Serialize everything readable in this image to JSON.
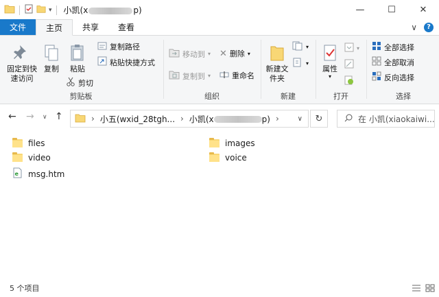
{
  "window": {
    "title_prefix": "小凯(x",
    "title_suffix": "p)",
    "minimize": "—",
    "maximize": "☐",
    "close": "✕"
  },
  "tabs": {
    "file": "文件",
    "home": "主页",
    "share": "共享",
    "view": "查看",
    "collapse": "∨",
    "help": "?"
  },
  "ribbon": {
    "clipboard": {
      "label": "剪贴板",
      "pin": "固定到快速访问",
      "copy": "复制",
      "paste": "粘贴",
      "copy_path": "复制路径",
      "paste_shortcut": "粘贴快捷方式",
      "cut": "剪切"
    },
    "organize": {
      "label": "组织",
      "move_to": "移动到",
      "copy_to": "复制到",
      "delete": "删除",
      "rename": "重命名"
    },
    "new": {
      "label": "新建",
      "new_folder": "新建文件夹"
    },
    "open": {
      "label": "打开",
      "properties": "属性"
    },
    "select": {
      "label": "选择",
      "select_all": "全部选择",
      "select_none": "全部取消",
      "invert": "反向选择"
    }
  },
  "address": {
    "crumb1": "小五(wxid_28tgh...",
    "crumb2_prefix": "小凯(x",
    "crumb2_suffix": "p)",
    "search_placeholder": "在 小凯(xiaokaiwi..."
  },
  "files": [
    {
      "name": "files",
      "type": "folder"
    },
    {
      "name": "images",
      "type": "folder"
    },
    {
      "name": "video",
      "type": "folder"
    },
    {
      "name": "voice",
      "type": "folder"
    },
    {
      "name": "msg.htm",
      "type": "htm"
    }
  ],
  "status": {
    "count": "5 个项目"
  },
  "colors": {
    "accent": "#1979ca",
    "folder": "#f8d775"
  }
}
